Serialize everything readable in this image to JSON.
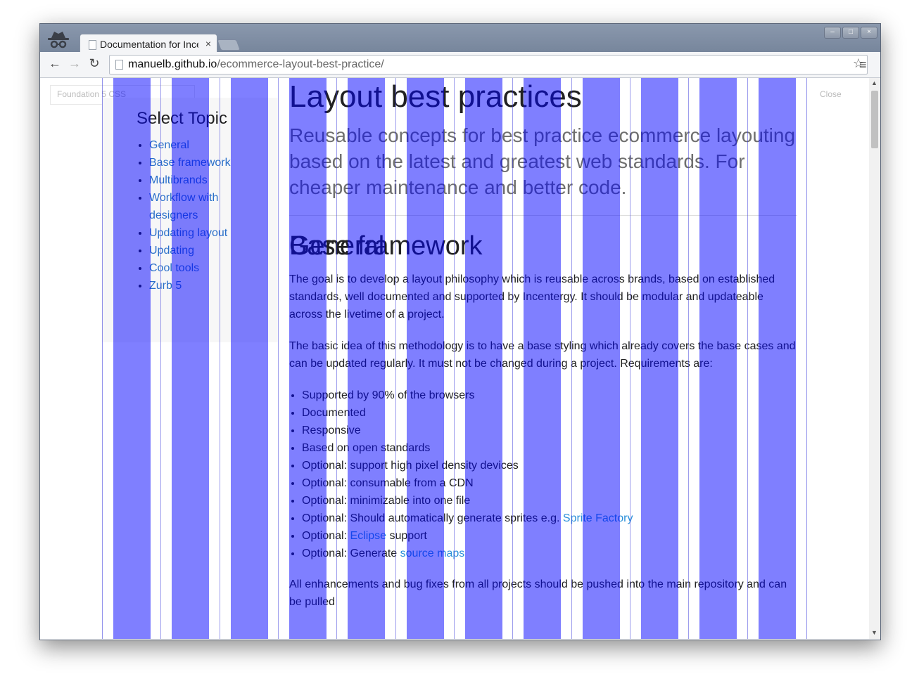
{
  "browser": {
    "tab_title": "Documentation for Incentergy",
    "tab_close": "×",
    "url_host": "manuelb.github.io",
    "url_path": "/ecommerce-layout-best-practice/",
    "window_buttons": [
      "–",
      "□",
      "×"
    ],
    "icons": [
      "incognito-icon",
      "page-icon",
      "back-icon",
      "forward-icon",
      "reload-icon",
      "bookmark-star-icon",
      "chrome-menu-icon"
    ]
  },
  "ghost_bar": {
    "left_label": "Foundation 5 CSS",
    "right_label": "Close"
  },
  "sidebar": {
    "title": "Select Topic",
    "items": [
      {
        "label": "General"
      },
      {
        "label": "Base framework"
      },
      {
        "label": "Multibrands"
      },
      {
        "label": "Workflow with designers"
      },
      {
        "label": "Updating layout"
      },
      {
        "label": "Updating"
      },
      {
        "label": "Cool tools"
      },
      {
        "label": "Zurb 5"
      }
    ]
  },
  "main": {
    "title": "Layout best practices",
    "subheader": "Reusable concepts for best practice ecommerce layouting based on the latest and greatest web standards. For cheaper maintenance and better code.",
    "general_heading": "General",
    "para1": "The goal is to develop a layout philosophy which is reusable across brands, based on established standards, well documented and supported by Incentergy. It should be modular and updateable across the livetime of a project.",
    "para2": "The basic idea of this methodology is to have a base styling which already covers the base cases and can be updated regularly. It must not be changed during a project. Requirements are:",
    "requirements": [
      {
        "text": "Supported by 90% of the browsers"
      },
      {
        "text": "Documented"
      },
      {
        "text": "Responsive"
      },
      {
        "text": "Based on open standards"
      },
      {
        "text": "Optional: support high pixel density devices"
      },
      {
        "text": "Optional: consumable from a CDN"
      },
      {
        "text": "Optional: minimizable into one file"
      },
      {
        "text": "Optional: Should automatically generate sprites e.g. ",
        "link": "Sprite Factory"
      },
      {
        "text": "Optional: ",
        "link": "Eclipse",
        "suffix": " support"
      },
      {
        "text": "Optional: Generate ",
        "link": "source maps"
      }
    ],
    "para3": "All enhancements and bug fixes from all projects should be pushed into the main repository and can be pulled",
    "next_heading": "Base framework"
  },
  "colors": {
    "grid_column": "#0000ff",
    "link": "#2a6fc9",
    "titlebar": "#8494ab"
  }
}
